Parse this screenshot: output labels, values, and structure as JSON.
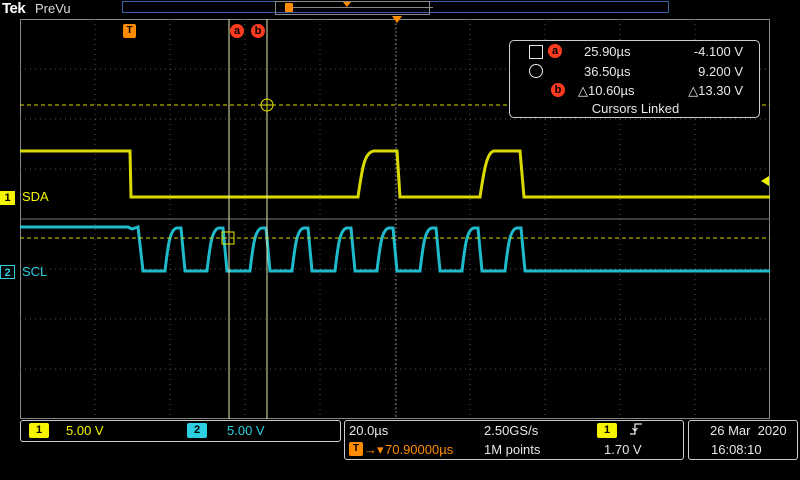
{
  "top": {
    "logo": "Tek",
    "mode": "PreVu"
  },
  "trigger_marker": "T",
  "cursor_badges": {
    "a": "a",
    "b": "b"
  },
  "channels": {
    "ch1": {
      "number": "1",
      "name": "SDA",
      "color": "#f4f400",
      "scale": "5.00 V"
    },
    "ch2": {
      "number": "2",
      "name": "SCL",
      "color": "#2bcfe0",
      "scale": "5.00 V"
    }
  },
  "cursor_readout": {
    "a": {
      "badge": "a",
      "time": "25.90µs",
      "volt": "-4.100 V"
    },
    "b": {
      "time": "36.50µs",
      "volt": "9.200 V"
    },
    "delta": {
      "badge": "b",
      "time": "△10.60µs",
      "volt": "△13.30 V"
    },
    "linked": "Cursors Linked"
  },
  "horizontal": {
    "time_div": "20.0µs",
    "sample_rate": "2.50GS/s",
    "trigger_source": "1",
    "trigger_type_icon": "rising-edge-icon",
    "trigger_position": "70.90000µs",
    "record_length": "1M points",
    "trigger_level": "1.70 V"
  },
  "date": {
    "day": "26 Mar  2020",
    "time": "16:08:10"
  },
  "accent_color": "#ff8c00"
}
